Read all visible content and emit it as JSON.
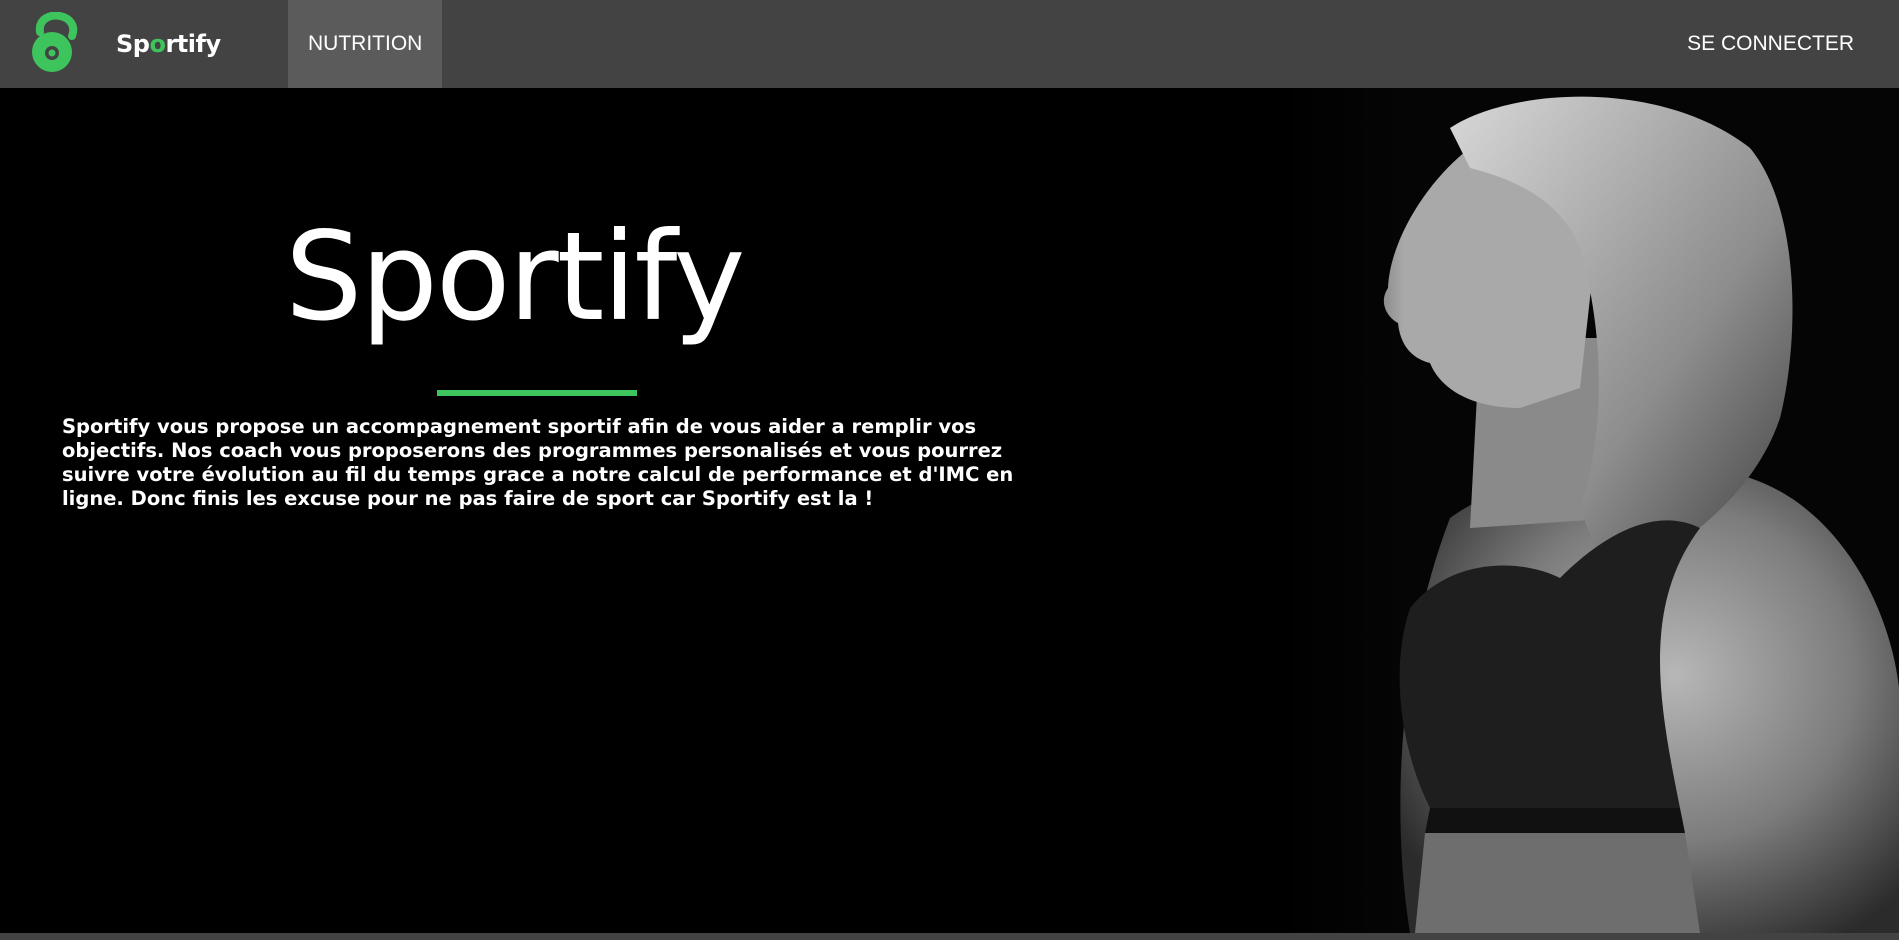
{
  "brand": {
    "logo_icon": "kettlebell-icon",
    "name_before": "Sp",
    "name_o": "o",
    "name_after": "rtify",
    "accent_color": "#3ec45c"
  },
  "nav": {
    "items": [
      {
        "label": "NUTRITION",
        "active": true
      }
    ],
    "login_label": "SE CONNECTER"
  },
  "hero": {
    "title": "Sportify",
    "description": "Sportify vous propose un accompagnement sportif afin de vous aider a remplir vos objectifs. Nos coach vous proposerons des programmes personalisés et vous pourrez suivre votre évolution au fil du temps grace a notre calcul de performance et d'IMC en ligne. Donc finis les excuse pour ne pas faire de sport car Sportify est la !",
    "image": "athlete-woman-profile-photo"
  },
  "colors": {
    "navbar_bg": "#434343",
    "nav_active_bg": "#5b5b5b",
    "hero_bg": "#000000",
    "accent": "#3ec45c"
  }
}
